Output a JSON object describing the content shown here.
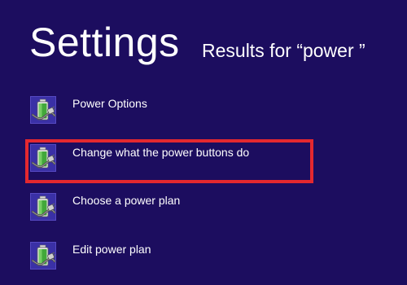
{
  "header": {
    "title": "Settings",
    "subtitle": "Results for “power ”"
  },
  "results": [
    {
      "label": "Power Options",
      "icon": "power-battery-icon",
      "selected": false
    },
    {
      "label": "Change what the power buttons do",
      "icon": "power-battery-icon",
      "selected": true
    },
    {
      "label": "Choose a power plan",
      "icon": "power-battery-icon",
      "selected": false
    },
    {
      "label": "Edit power plan",
      "icon": "power-battery-icon",
      "selected": false
    }
  ],
  "colors": {
    "background": "#1c0d5f",
    "text": "#ffffff",
    "selection_outline": "#e4282f",
    "icon_tile": "#3b2fa3"
  }
}
